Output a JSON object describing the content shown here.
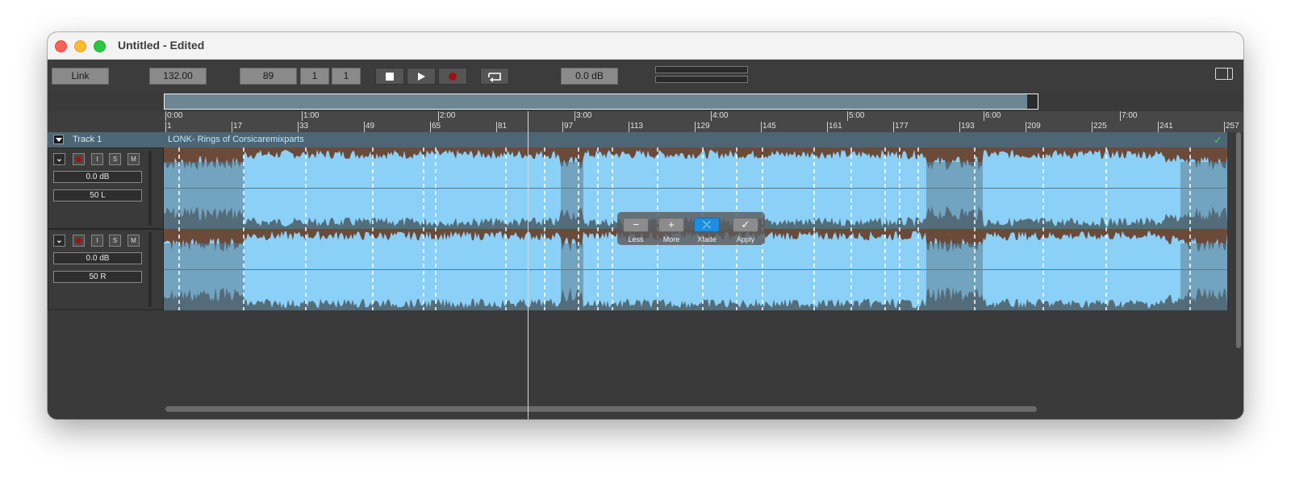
{
  "window": {
    "title": "Untitled - Edited"
  },
  "toolbar": {
    "link_label": "Link",
    "tempo": "132.00",
    "position_bar": "89",
    "position_beat": "1",
    "position_tick": "1",
    "volume": "0.0 dB",
    "icons": [
      "stop-icon",
      "play-icon",
      "record-icon",
      "loop-icon",
      "inspector-icon"
    ]
  },
  "ruler": {
    "time_labels": [
      "0:00",
      "1:00",
      "2:00",
      "3:00",
      "4:00",
      "5:00",
      "6:00",
      "7:00"
    ],
    "bar_labels": [
      "1",
      "17",
      "33",
      "49",
      "65",
      "81",
      "97",
      "113",
      "129",
      "145",
      "161",
      "177",
      "193",
      "209",
      "225",
      "241",
      "257"
    ]
  },
  "track": {
    "name": "Track 1",
    "clip_name": "LONK- Rings of Corsicaremixparts",
    "channels": [
      {
        "volume": "0.0 dB",
        "pan": "50 L",
        "buttons": [
          "I",
          "S",
          "M"
        ]
      },
      {
        "volume": "0.0 dB",
        "pan": "50 R",
        "buttons": [
          "I",
          "S",
          "M"
        ]
      }
    ]
  },
  "popup": {
    "buttons": [
      {
        "label": "Less",
        "icon": "minus-icon",
        "glyph": "−"
      },
      {
        "label": "More",
        "icon": "plus-icon",
        "glyph": "+"
      },
      {
        "label": "Xfade",
        "icon": "crossfade-icon",
        "glyph": "⤫"
      },
      {
        "label": "Apply",
        "icon": "checkmark-icon",
        "glyph": "✓"
      }
    ]
  },
  "colors": {
    "waveform_fill": "#8ad0f7",
    "waveform_dark": "#556c79",
    "clip_brown": "#6b4a3a",
    "clip_header": "#4d6675",
    "active_button": "#1e8fe0"
  }
}
